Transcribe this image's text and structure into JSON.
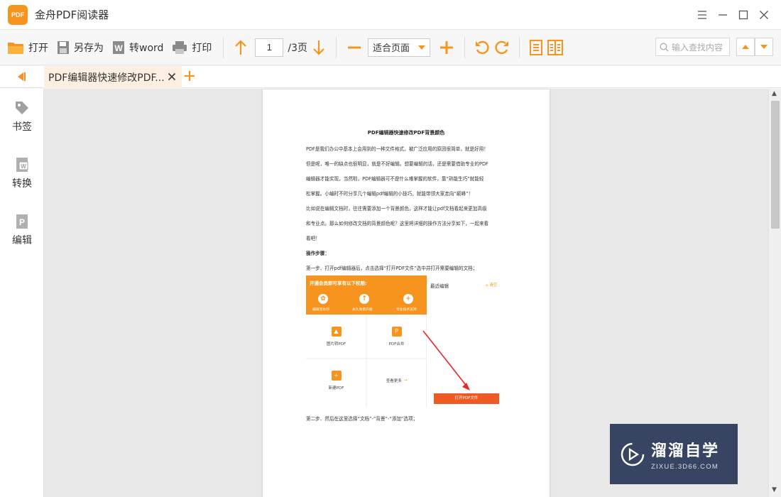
{
  "app": {
    "logo_text": "PDF",
    "title": "金舟PDF阅读器"
  },
  "toolbar": {
    "open_label": "打开",
    "save_as_label": "另存为",
    "to_word_label": "转word",
    "print_label": "打印",
    "current_page": "1",
    "total_pages": "/3页",
    "zoom_mode": "适合页面",
    "search_placeholder": "输入查找内容"
  },
  "tabs": [
    {
      "label": "PDF编辑器快速修改PDF...",
      "active": true
    }
  ],
  "sidebar": {
    "items": [
      {
        "label": "书签",
        "icon": "tag-icon"
      },
      {
        "label": "转换",
        "icon": "convert-icon"
      },
      {
        "label": "编辑",
        "icon": "edit-icon"
      }
    ]
  },
  "document": {
    "title": "PDF编辑器快速修改PDF背景颜色",
    "lines": [
      "PDF是我们办公中基本上会用到的一种文件格式，被广泛应用的原因很简单，就是好用！",
      "但是呢，唯一的缺点也很明显，就是不好编辑。想要编辑的话，还是需要借助专业的PDF",
      "编辑器才能实现，当然啦，PDF编辑器可不是什么难掌握的软件，靠“熟能生巧”就能轻",
      "松掌握。小编时不时分享几个编辑pdf编辑的小技巧，就能带领大家走向“巅峰”！",
      "比如说在编辑文档时，往往需要添加一个背景颜色，这样才能让pdf文档看起来更加高级",
      "和专业点。那么如何修改文档的背景颜色呢？这里将详细的操作方法分享如下，一起来看",
      "看吧！"
    ],
    "steps_heading": "操作步骤：",
    "step1": "第一步、打开pdf编辑器后，点击选择“打开PDF文件”选中并打开需要编辑的文档；",
    "step2": "第二步、然后在这里选择“文档”-“背景”-“添加”选项；",
    "embedded": {
      "banner_title": "开通会员即可享有以下权限:",
      "features": [
        "编辑无水印",
        "永久免费升级",
        "专业技术支持"
      ],
      "recent_label": "最近编辑",
      "clear_label": "清空",
      "tiles": [
        "图片转PDF",
        "PDF合并",
        "新建PDF",
        "查看更多"
      ],
      "open_button": "打开PDF文件"
    }
  },
  "watermark": {
    "main": "溜溜自学",
    "sub": "ZIXUE.3D66.COM"
  },
  "colors": {
    "accent": "#f7941d",
    "tab_bg": "#fdf0e2",
    "arrow_red": "#e8262b"
  }
}
